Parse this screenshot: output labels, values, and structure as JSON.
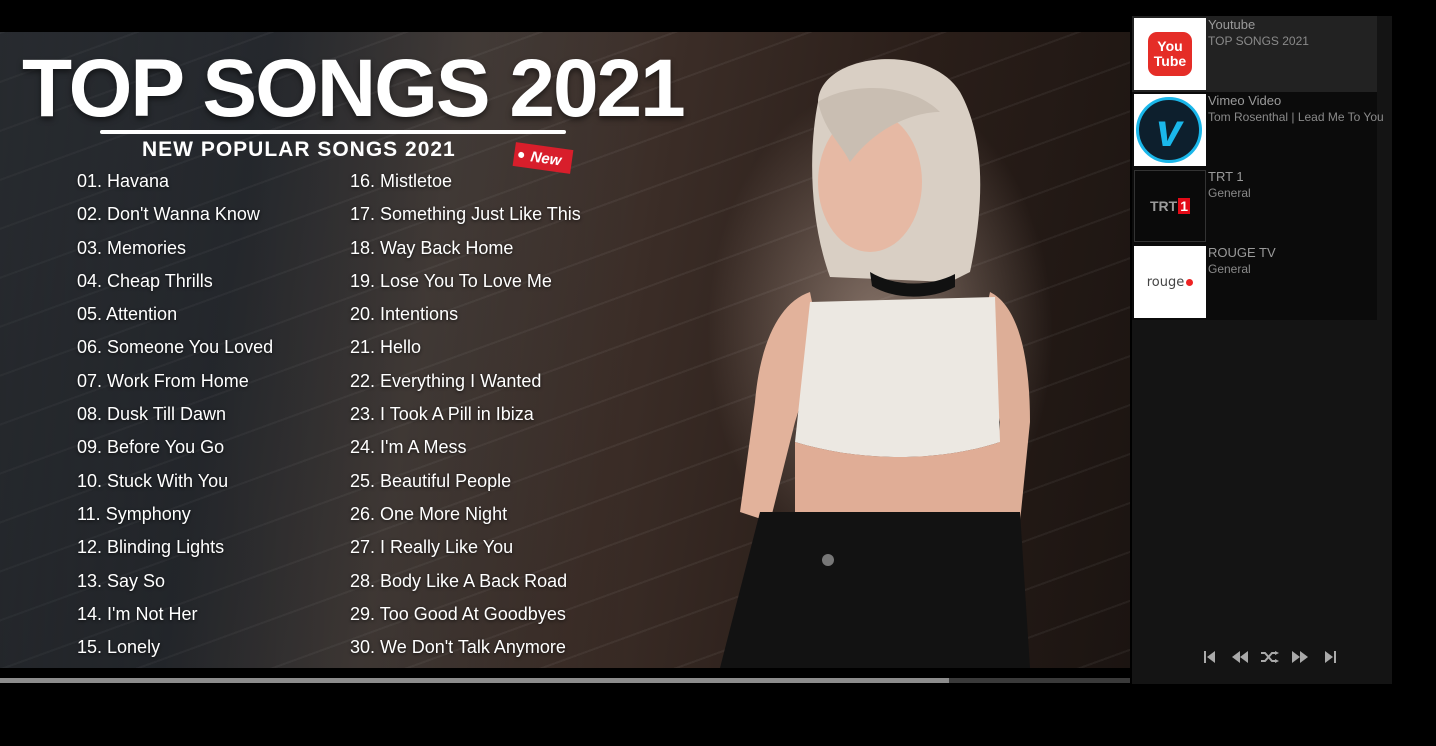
{
  "video": {
    "title": "TOP SONGS 2021",
    "subtitle": "NEW POPULAR SONGS 2021",
    "badge": "New",
    "songs_col1": [
      "01. Havana",
      "02. Don't Wanna Know",
      "03. Memories",
      "04. Cheap Thrills",
      "05. Attention",
      "06. Someone You Loved",
      "07. Work From Home",
      "08. Dusk Till Dawn",
      "09. Before You Go",
      "10. Stuck With You",
      "11. Symphony",
      "12. Blinding Lights",
      "13. Say So",
      "14. I'm Not Her",
      "15. Lonely"
    ],
    "songs_col2": [
      "16. Mistletoe",
      "17. Something Just Like This",
      "18. Way Back Home",
      "19. Lose You To Love Me",
      "20. Intentions",
      "21. Hello",
      "22. Everything I Wanted",
      "23. I Took A Pill in Ibiza",
      "24. I'm A Mess",
      "25. Beautiful People",
      "26. One More Night",
      "27. I Really Like You",
      "28. Body Like A Back Road",
      "29. Too Good At Goodbyes",
      "30. We Don't Talk Anymore"
    ],
    "progress": 0.84
  },
  "playlist": {
    "items": [
      {
        "title": "Youtube",
        "subtitle": "TOP SONGS 2021",
        "logo_line1": "You",
        "logo_line2": "Tube"
      },
      {
        "title": "Vimeo Video",
        "subtitle": "Tom Rosenthal | Lead Me To You",
        "logo": "v"
      },
      {
        "title": "TRT 1",
        "subtitle": "General",
        "logo_text": "TRT",
        "logo_num": "1"
      },
      {
        "title": "ROUGE TV",
        "subtitle": "General",
        "logo": "rouge"
      }
    ]
  },
  "controls": [
    "first-icon",
    "previous-icon",
    "shuffle-icon",
    "next-icon",
    "last-icon"
  ],
  "colors": {
    "youtube_red": "#e52d27",
    "vimeo_blue": "#1ab7ea",
    "trt_red": "#e30a17"
  }
}
